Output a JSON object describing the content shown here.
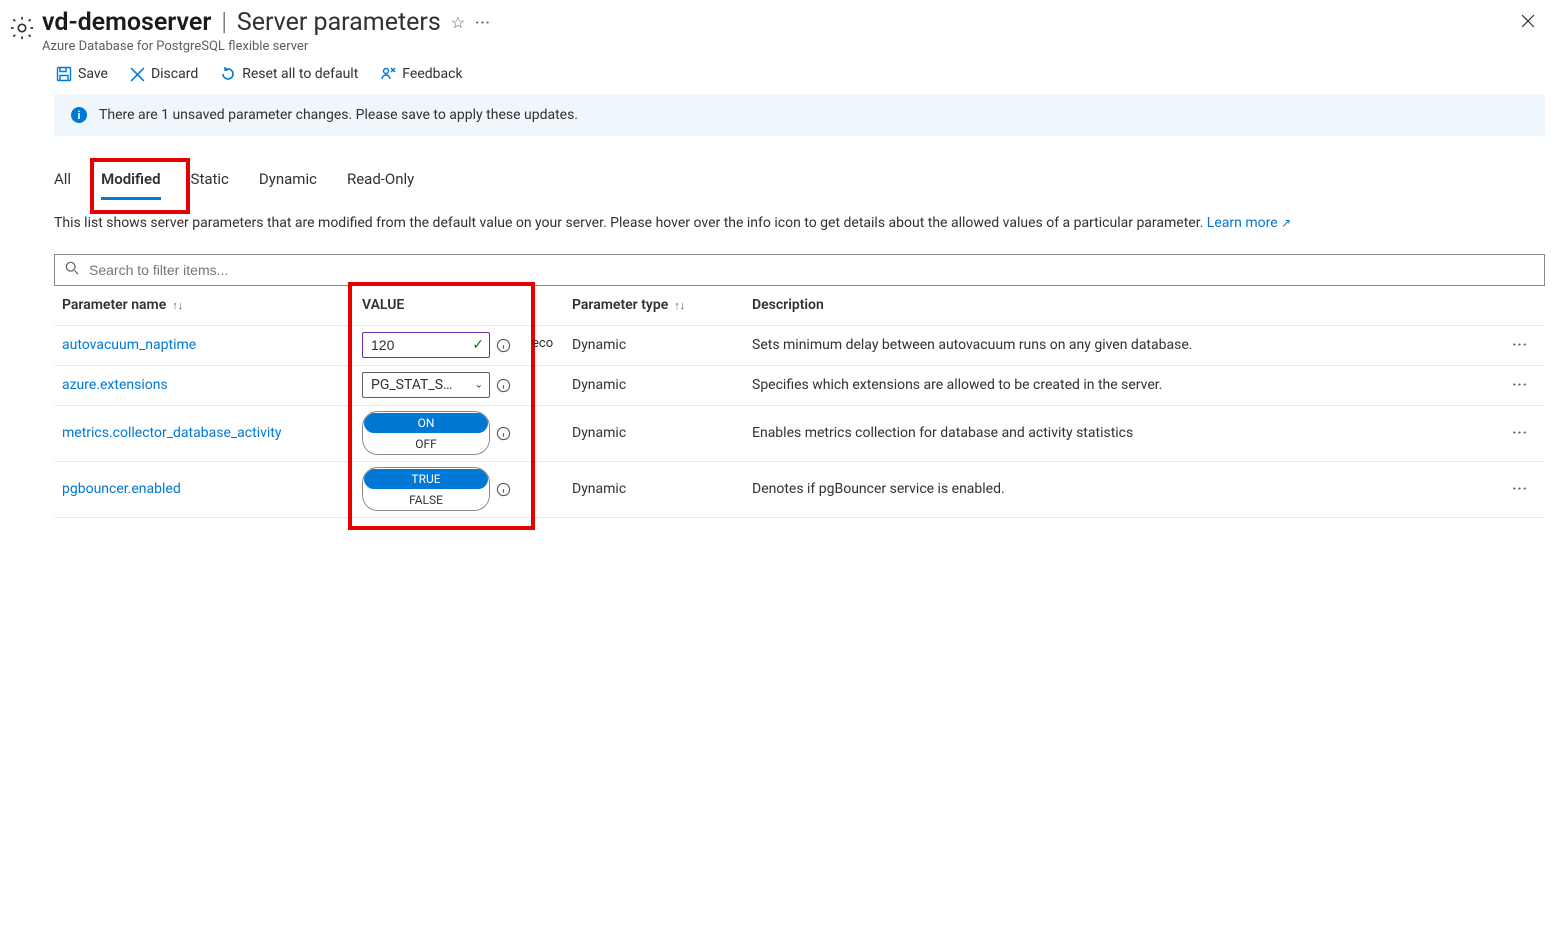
{
  "header": {
    "server_name": "vd-demoserver",
    "separator": "|",
    "page_title": "Server parameters",
    "subtitle": "Azure Database for PostgreSQL flexible server"
  },
  "commands": {
    "save": "Save",
    "discard": "Discard",
    "reset": "Reset all to default",
    "feedback": "Feedback"
  },
  "banner": {
    "message": "There are 1 unsaved parameter changes.  Please save to apply these updates."
  },
  "tabs": {
    "items": [
      "All",
      "Modified",
      "Static",
      "Dynamic",
      "Read-Only"
    ],
    "active_index": 1
  },
  "description": {
    "text": "This list shows server parameters that are modified from the default value on your server. Please hover over the info icon to get details about the allowed values of a particular parameter. ",
    "link": "Learn more"
  },
  "search": {
    "placeholder": "Search to filter items..."
  },
  "columns": {
    "name": "Parameter name",
    "value": "VALUE",
    "type": "Parameter type",
    "desc": "Description"
  },
  "rows": [
    {
      "name": "autovacuum_naptime",
      "value_kind": "text",
      "value": "120",
      "overflow_text": "eco",
      "type": "Dynamic",
      "desc": "Sets minimum delay between autovacuum runs on any given database."
    },
    {
      "name": "azure.extensions",
      "value_kind": "dropdown",
      "value": "PG_STAT_S…",
      "type": "Dynamic",
      "desc": "Specifies which extensions are allowed to be created in the server."
    },
    {
      "name": "metrics.collector_database_activity",
      "value_kind": "toggle",
      "opt_on": "ON",
      "opt_off": "OFF",
      "active": "on",
      "type": "Dynamic",
      "desc": "Enables metrics collection for database and activity statistics"
    },
    {
      "name": "pgbouncer.enabled",
      "value_kind": "toggle",
      "opt_on": "TRUE",
      "opt_off": "FALSE",
      "active": "on",
      "type": "Dynamic",
      "desc": "Denotes if pgBouncer service is enabled."
    }
  ]
}
